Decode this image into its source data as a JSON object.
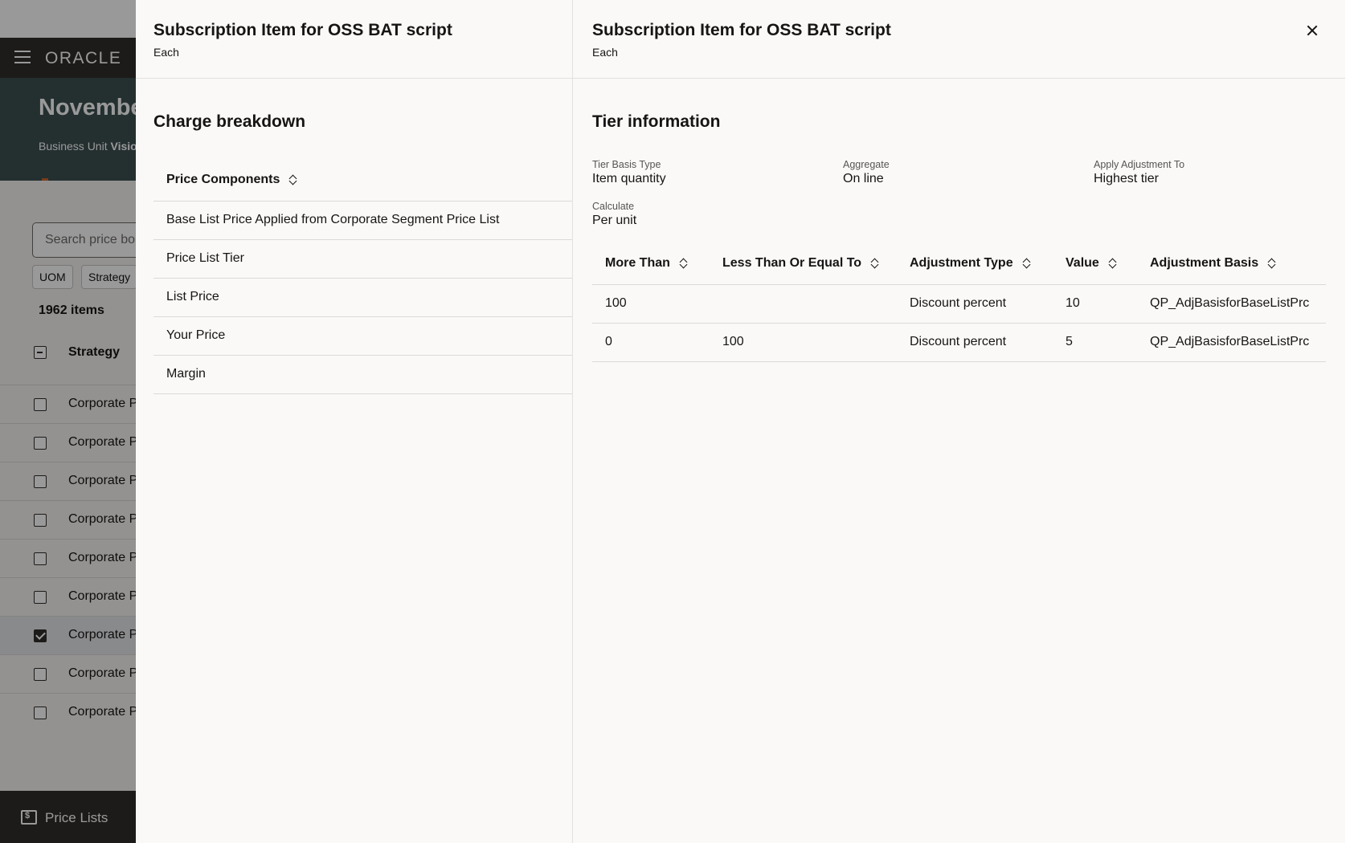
{
  "background": {
    "logo": "ORACLE",
    "banner_title": "Novembe",
    "banner_sub_prefix": "Business Unit",
    "banner_sub_value": "Visio",
    "search_placeholder": "Search price bo",
    "chips": [
      "UOM",
      "Strategy"
    ],
    "item_count": "1962 items",
    "column_header": "Strategy",
    "rows": [
      {
        "label": "Corporate P",
        "checked": false
      },
      {
        "label": "Corporate P",
        "checked": false
      },
      {
        "label": "Corporate P",
        "checked": false
      },
      {
        "label": "Corporate P",
        "checked": false
      },
      {
        "label": "Corporate P",
        "checked": false
      },
      {
        "label": "Corporate P",
        "checked": false
      },
      {
        "label": "Corporate P",
        "checked": true
      },
      {
        "label": "Corporate P",
        "checked": false
      },
      {
        "label": "Corporate P",
        "checked": false
      }
    ],
    "footer_label": "Price Lists"
  },
  "left_drawer": {
    "title": "Subscription Item for OSS BAT script",
    "subtitle": "Each",
    "section_title": "Charge breakdown",
    "column_header": "Price Components",
    "rows": [
      "Base List Price Applied from Corporate Segment Price List",
      "Price List Tier",
      "List Price",
      "Your Price",
      "Margin"
    ]
  },
  "right_drawer": {
    "title": "Subscription Item for OSS BAT script",
    "subtitle": "Each",
    "section_title": "Tier information",
    "fields": {
      "tier_basis_type": {
        "label": "Tier Basis Type",
        "value": "Item quantity"
      },
      "aggregate": {
        "label": "Aggregate",
        "value": "On line"
      },
      "apply_adjustment_to": {
        "label": "Apply Adjustment To",
        "value": "Highest tier"
      },
      "calculate": {
        "label": "Calculate",
        "value": "Per unit"
      }
    },
    "table": {
      "headers": [
        "More Than",
        "Less Than Or Equal To",
        "Adjustment Type",
        "Value",
        "Adjustment Basis"
      ],
      "rows": [
        [
          "100",
          "",
          "Discount percent",
          "10",
          "QP_AdjBasisforBaseListPrc"
        ],
        [
          "0",
          "100",
          "Discount percent",
          "5",
          "QP_AdjBasisforBaseListPrc"
        ]
      ]
    }
  }
}
